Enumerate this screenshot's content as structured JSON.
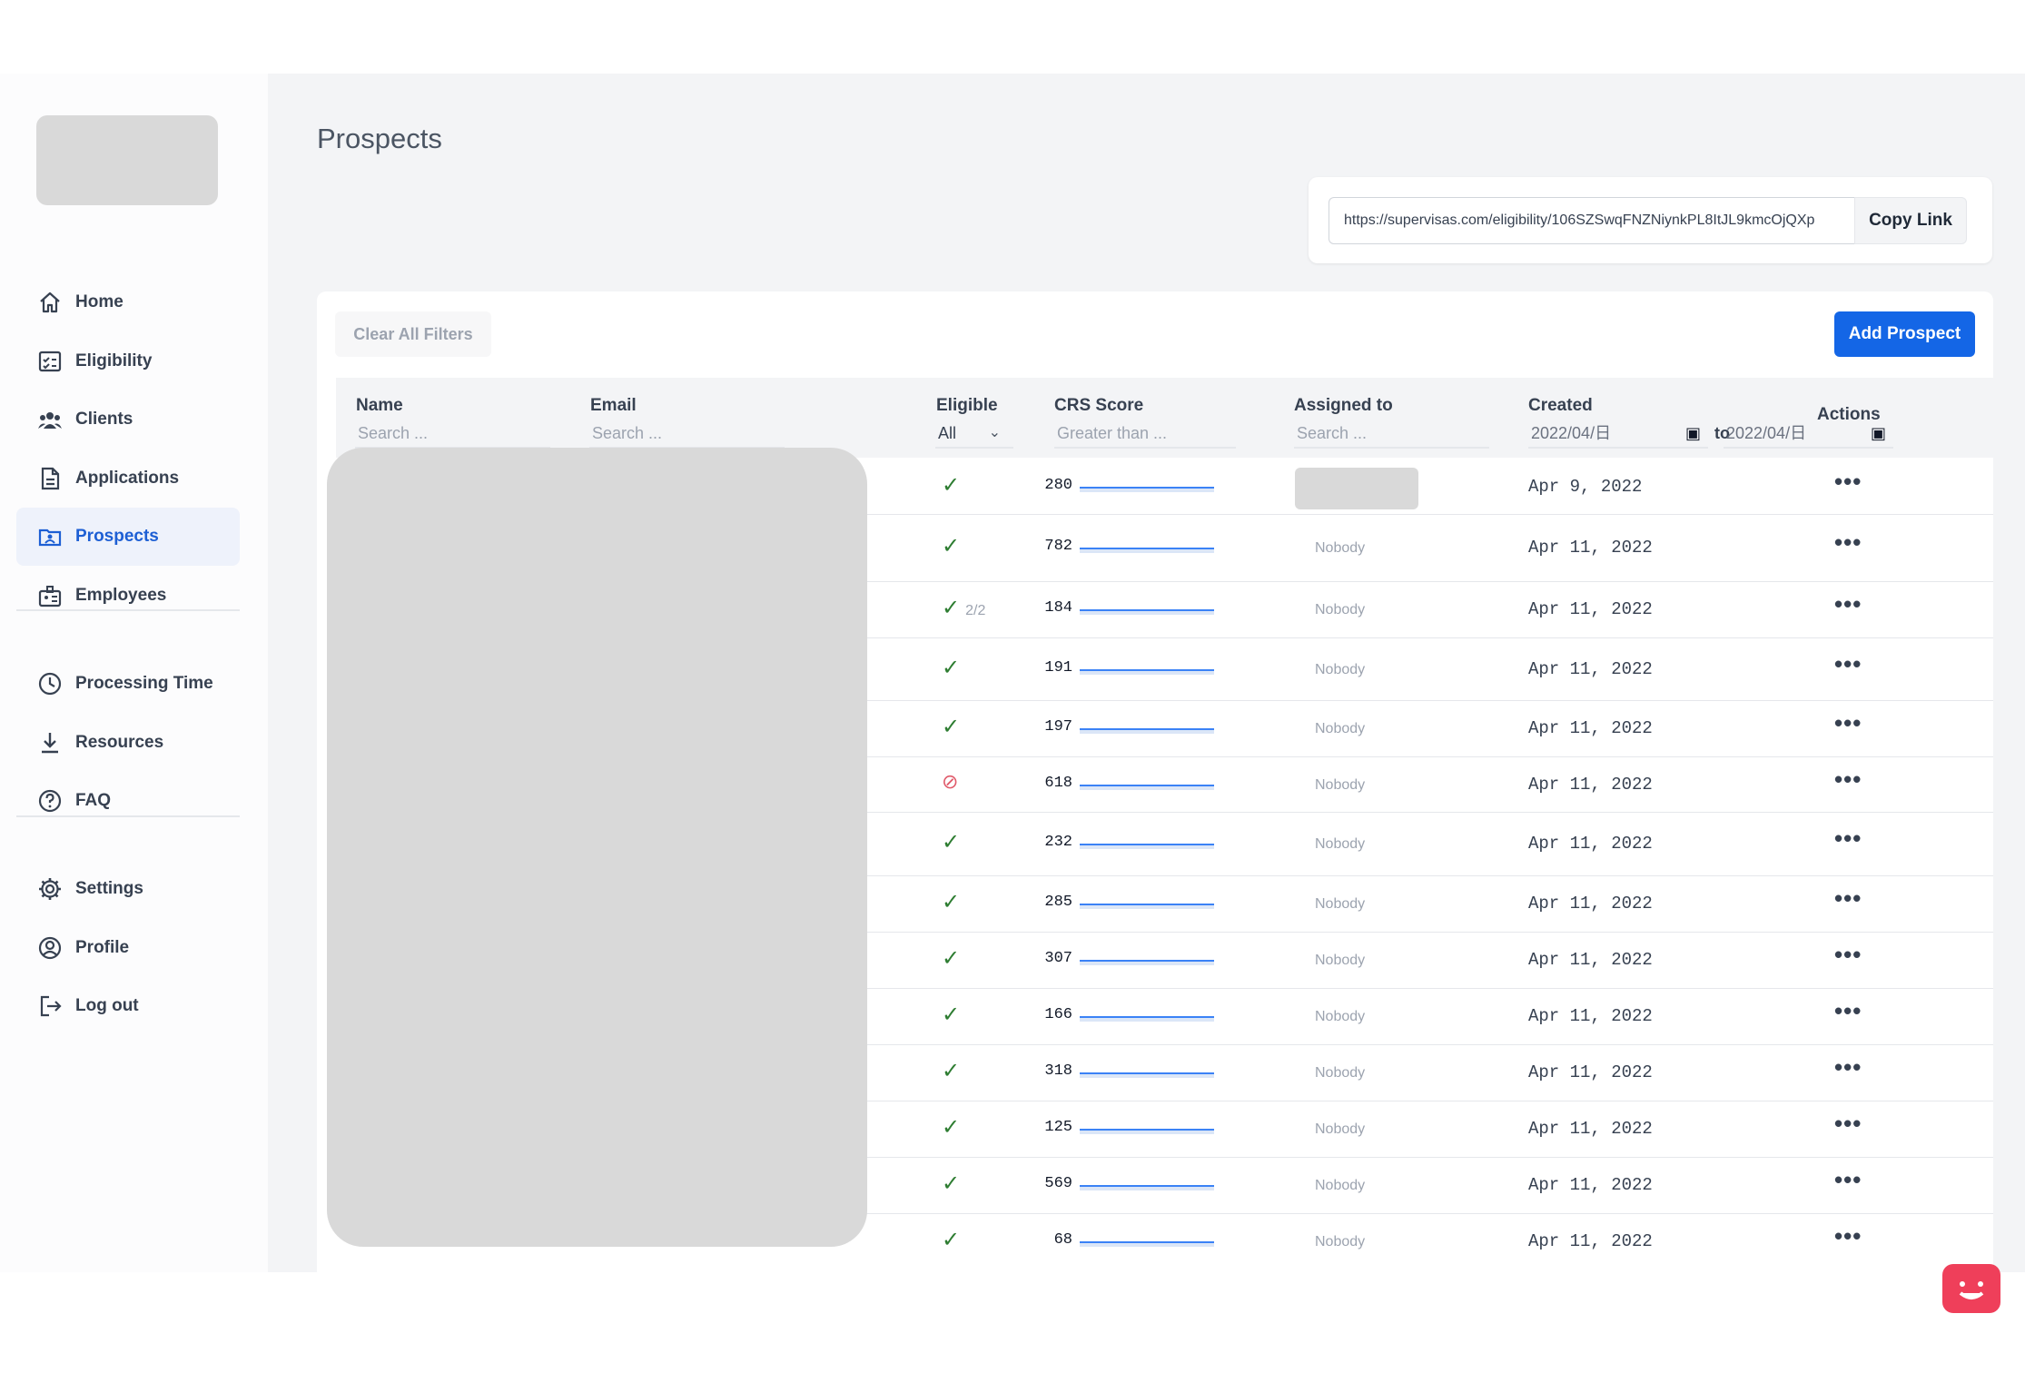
{
  "sidebar": {
    "nav_top": [
      {
        "label": "Home",
        "icon": "home-icon"
      },
      {
        "label": "Eligibility",
        "icon": "checklist-icon"
      },
      {
        "label": "Clients",
        "icon": "users-icon"
      },
      {
        "label": "Applications",
        "icon": "document-icon"
      },
      {
        "label": "Prospects",
        "icon": "folder-user-icon",
        "active": true
      },
      {
        "label": "Employees",
        "icon": "badge-icon"
      }
    ],
    "nav_mid": [
      {
        "label": "Processing Time",
        "icon": "clock-icon"
      },
      {
        "label": "Resources",
        "icon": "download-icon"
      },
      {
        "label": "FAQ",
        "icon": "question-icon"
      }
    ],
    "nav_bottom": [
      {
        "label": "Settings",
        "icon": "gear-icon"
      },
      {
        "label": "Profile",
        "icon": "user-circle-icon"
      },
      {
        "label": "Log out",
        "icon": "logout-icon"
      }
    ]
  },
  "page": {
    "title": "Prospects",
    "share_link": "https://supervisas.com/eligibility/106SZSwqFNZNiynkPL8ItJL9kmcOjQXp",
    "copy_label": "Copy Link",
    "clear_filters_label": "Clear All Filters",
    "add_prospect_label": "Add Prospect"
  },
  "table": {
    "headers": {
      "name": "Name",
      "email": "Email",
      "eligible": "Eligible",
      "crs": "CRS Score",
      "assigned": "Assigned to",
      "created": "Created",
      "actions": "Actions"
    },
    "filters": {
      "name_placeholder": "Search ...",
      "email_placeholder": "Search ...",
      "eligible_value": "All",
      "crs_placeholder": "Greater than ...",
      "assigned_placeholder": "Search ...",
      "created_from": "2022/04/日",
      "created_to_label": "to",
      "created_to": "2022/04/日"
    },
    "rows": [
      {
        "eligible": true,
        "sub": "",
        "score": "280",
        "assigned": "",
        "created": "Apr 9, 2022",
        "actions": "•••"
      },
      {
        "eligible": true,
        "sub": "",
        "score": "782",
        "assigned": "Nobody",
        "created": "Apr 11, 2022",
        "actions": "•••"
      },
      {
        "eligible": true,
        "sub": "2/2",
        "score": "184",
        "assigned": "Nobody",
        "created": "Apr 11, 2022",
        "actions": "•••"
      },
      {
        "eligible": true,
        "sub": "",
        "score": "191",
        "assigned": "Nobody",
        "created": "Apr 11, 2022",
        "actions": "•••"
      },
      {
        "eligible": true,
        "sub": "",
        "score": "197",
        "assigned": "Nobody",
        "created": "Apr 11, 2022",
        "actions": "•••"
      },
      {
        "eligible": false,
        "sub": "",
        "score": "618",
        "assigned": "Nobody",
        "created": "Apr 11, 2022",
        "actions": "•••"
      },
      {
        "eligible": true,
        "sub": "",
        "score": "232",
        "assigned": "Nobody",
        "created": "Apr 11, 2022",
        "actions": "•••"
      },
      {
        "eligible": true,
        "sub": "",
        "score": "285",
        "assigned": "Nobody",
        "created": "Apr 11, 2022",
        "actions": "•••"
      },
      {
        "eligible": true,
        "sub": "",
        "score": "307",
        "assigned": "Nobody",
        "created": "Apr 11, 2022",
        "actions": "•••"
      },
      {
        "eligible": true,
        "sub": "",
        "score": "166",
        "assigned": "Nobody",
        "created": "Apr 11, 2022",
        "actions": "•••"
      },
      {
        "eligible": true,
        "sub": "",
        "score": "318",
        "assigned": "Nobody",
        "created": "Apr 11, 2022",
        "actions": "•••"
      },
      {
        "eligible": true,
        "sub": "",
        "score": "125",
        "assigned": "Nobody",
        "created": "Apr 11, 2022",
        "actions": "•••"
      },
      {
        "eligible": true,
        "sub": "",
        "score": "569",
        "assigned": "Nobody",
        "created": "Apr 11, 2022",
        "actions": "•••"
      },
      {
        "eligible": true,
        "sub": "",
        "score": "68",
        "assigned": "Nobody",
        "created": "Apr 11, 2022",
        "actions": "•••"
      }
    ]
  },
  "colors": {
    "accent": "#1466e6",
    "eligible_check": "#2e7d32",
    "ineligible": "#e05a6a",
    "chat_widget": "#ef3f5a"
  }
}
